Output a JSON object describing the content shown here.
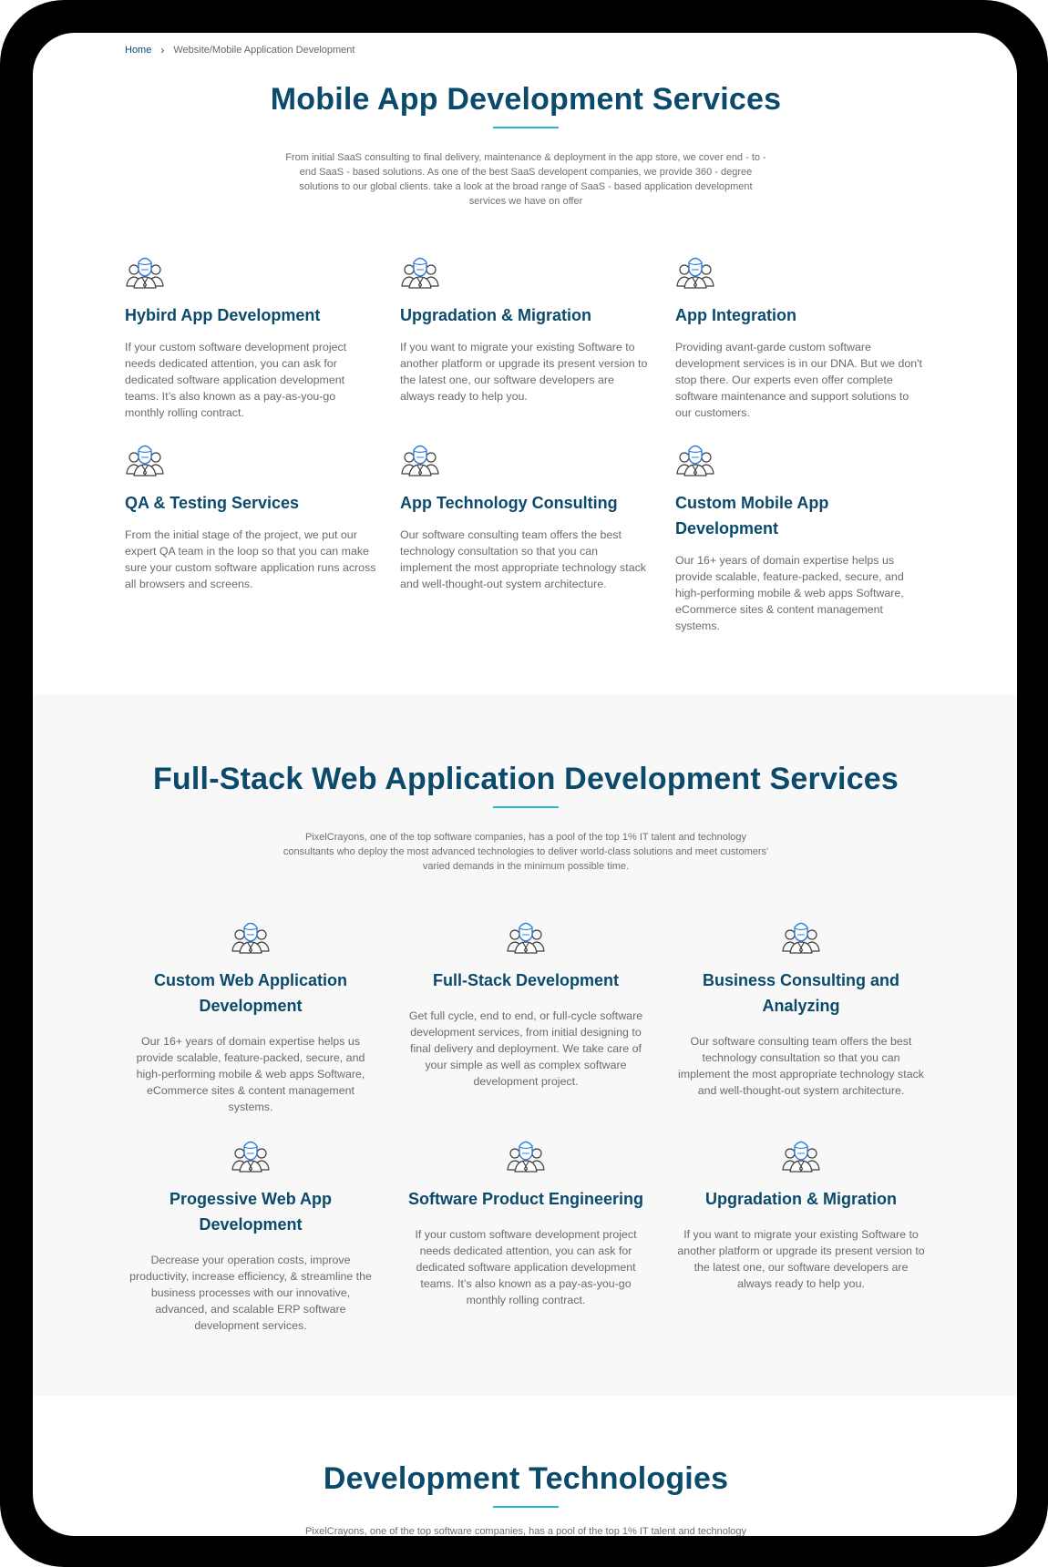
{
  "breadcrumb": {
    "home": "Home",
    "separator": "›",
    "current": "Website/Mobile Application Development"
  },
  "mobile_section": {
    "title": "Mobile App Development Services",
    "intro": "From initial SaaS consulting to final delivery, maintenance & deployment in the app store, we cover end - to - end SaaS - based solutions. As one of the best SaaS developent companies, we provide 360 - degree solutions to our global clients. take a look at the broad range of SaaS - based application development services we have on offer",
    "cards": [
      {
        "icon": "team-icon",
        "title": "Hybird App Development",
        "text": "If your custom software development project needs dedicated attention, you can ask for dedicated software application development teams. It’s also known as a pay-as-you-go monthly rolling contract."
      },
      {
        "icon": "team-icon",
        "title": "Upgradation & Migration",
        "text": "If you want to migrate your existing Software to another platform or upgrade its present version to the latest one, our software developers are always ready to help you."
      },
      {
        "icon": "team-icon",
        "title": "App Integration",
        "text": "Providing avant-garde custom software development services is in our DNA. But we don't stop there. Our experts even offer complete software maintenance and support solutions to our customers."
      },
      {
        "icon": "team-icon",
        "title": "QA & Testing Services",
        "text": "From the initial stage of the project, we put our expert QA team in the loop so that you can make sure your custom software application runs across all browsers and screens."
      },
      {
        "icon": "team-icon",
        "title": "App Technology Consulting",
        "text": "Our software consulting team offers the best technology consultation so that you can implement the most appropriate technology stack and well-thought-out system architecture."
      },
      {
        "icon": "team-icon",
        "title": "Custom Mobile App Development",
        "text": "Our 16+ years of domain expertise helps us provide scalable, feature-packed, secure, and high-performing mobile & web apps Software, eCommerce sites & content management systems."
      }
    ]
  },
  "fullstack_section": {
    "title": "Full-Stack Web Application Development Services",
    "intro": "PixelCrayons, one of the top software companies, has a pool of the top 1% IT talent and technology consultants who deploy the most advanced technologies to deliver world-class solutions and meet customers' varied demands in the minimum possible time.",
    "cards": [
      {
        "icon": "team-icon",
        "title": "Custom Web Application Development",
        "text": "Our 16+ years of domain expertise helps us provide scalable, feature-packed, secure, and high-performing mobile & web apps Software, eCommerce sites & content management systems."
      },
      {
        "icon": "team-icon",
        "title": "Full-Stack Development",
        "text": "Get full cycle, end to end, or full-cycle software development services, from initial designing to final delivery and deployment. We take care of your simple as well as complex software development project."
      },
      {
        "icon": "team-icon",
        "title": "Business Consulting and Analyzing",
        "text": "Our software consulting team offers the best technology consultation so that you can implement the most appropriate technology stack and well-thought-out system architecture."
      },
      {
        "icon": "team-icon",
        "title": "Progessive Web App Development",
        "text": "Decrease your operation costs, improve productivity, increase efficiency, & streamline the business processes with our innovative, advanced, and scalable ERP software development services."
      },
      {
        "icon": "team-icon",
        "title": "Software Product Engineering",
        "text": "If your custom software development project needs dedicated attention, you can ask for dedicated software application development teams. It’s also known as a pay-as-you-go monthly rolling contract."
      },
      {
        "icon": "team-icon",
        "title": "Upgradation & Migration",
        "text": "If you want to migrate your existing Software to another platform or upgrade its present version to the latest one, our software developers are always ready to help you."
      }
    ]
  },
  "tech_section": {
    "title": "Development Technologies",
    "intro": "PixelCrayons, one of the top software companies, has a pool of the top 1% IT talent and technology"
  },
  "colors": {
    "heading": "#0b4a6b",
    "accent": "#23b7d3",
    "body_text": "#6a6a6a",
    "gray_bg": "#f8f8f8"
  }
}
